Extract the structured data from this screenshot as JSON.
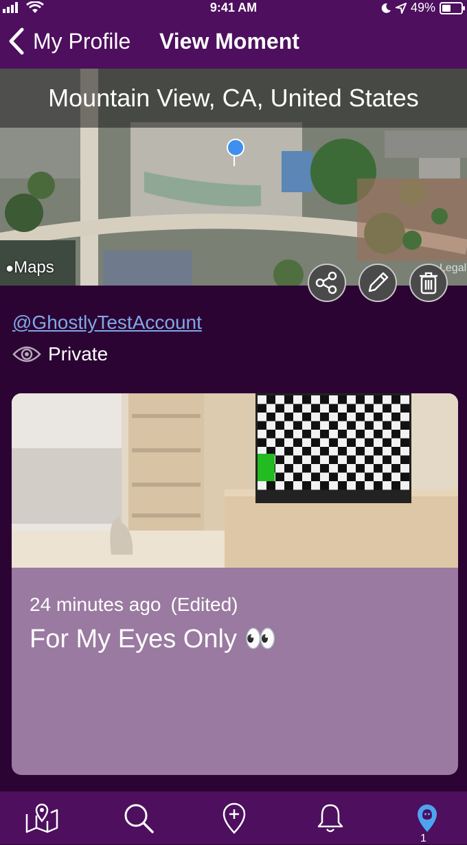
{
  "status": {
    "time": "9:41 AM",
    "battery": "49%",
    "battery_level": 0.49
  },
  "nav": {
    "back_label": "My Profile",
    "title": "View Moment"
  },
  "map": {
    "location": "Mountain View, CA, United States",
    "attribution": "Maps",
    "legal": "Legal"
  },
  "actions": {
    "icons": [
      "share-icon",
      "pencil-icon",
      "trash-icon"
    ]
  },
  "moment": {
    "username": "@GhostlyTestAccount",
    "visibility": "Private",
    "time_ago": "24 minutes ago",
    "edited": "(Edited)",
    "caption": "For My Eyes Only 👀"
  },
  "tabs": {
    "icons": [
      "map-icon",
      "search-icon",
      "add-location-icon",
      "bell-icon",
      "profile-pin-icon"
    ],
    "profile_badge": "1"
  },
  "colors": {
    "header": "#4d0f5e",
    "background": "#2c0433",
    "card": "#9a7aa0",
    "link": "#7fa8e8",
    "active_tab": "#4ea3f0"
  }
}
